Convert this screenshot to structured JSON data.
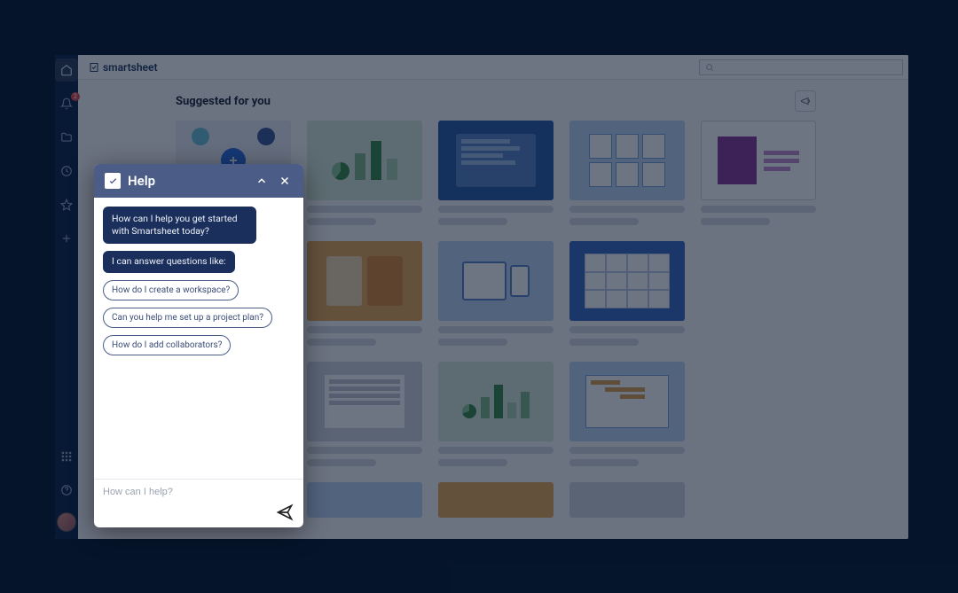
{
  "brand": "smartsheet",
  "search": {
    "placeholder": ""
  },
  "sidebar": {
    "notification_badge": "2"
  },
  "main": {
    "section_title": "Suggested for you"
  },
  "help": {
    "title": "Help",
    "greeting": "How can I help you get started with Smartsheet today?",
    "intro": "I can answer questions like:",
    "suggestions": [
      "How do I create a workspace?",
      "Can you help me set up a project plan?",
      "How do I add collaborators?"
    ],
    "input_placeholder": "How can I help?"
  }
}
